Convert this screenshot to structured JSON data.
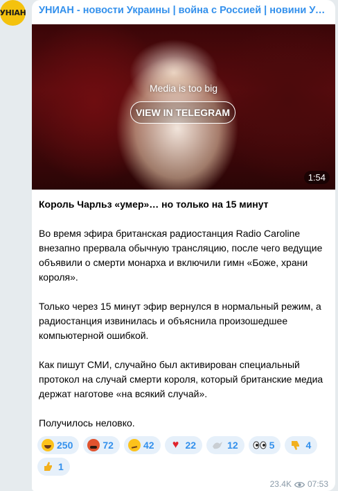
{
  "channel": {
    "avatar_text": "УНІАН",
    "title": "УНИАН - новости Украины | война с Россией | новини України | війна з Росією"
  },
  "media": {
    "notice": "Media is too big",
    "button_label": "VIEW IN TELEGRAM",
    "duration": "1:54"
  },
  "post": {
    "headline": "Король Чарльз «умер»… но только на 15 минут",
    "paragraphs": [
      "Во время эфира британская радиостанция Radio Caroline внезапно прервала обычную трансляцию, после чего ведущие объявили о смерти монарха и включили гимн «Боже, храни короля».",
      "Только через 15 минут эфир вернулся в нормальный режим, а радиостанция извинилась и объяснила произошедшее компьютерной ошибкой.",
      "Как пишут СМИ, случайно был активирован специальный протокол на случай смерти короля, который британские медиа держат наготове «на всякий случай».",
      "Получилось неловко."
    ]
  },
  "reactions": [
    {
      "icon": "grinning-face-icon",
      "count": "250"
    },
    {
      "icon": "angry-face-icon",
      "count": "72"
    },
    {
      "icon": "neutral-face-icon",
      "count": "42"
    },
    {
      "icon": "heart-icon",
      "count": "22"
    },
    {
      "icon": "dove-icon",
      "count": "12"
    },
    {
      "icon": "eyes-icon",
      "count": "5"
    },
    {
      "icon": "thumbs-down-icon",
      "count": "4"
    },
    {
      "icon": "thumbs-up-icon",
      "count": "1"
    }
  ],
  "footer": {
    "views": "23.4K",
    "time": "07:53"
  },
  "colors": {
    "accent": "#3390ec",
    "background": "#e6ebee",
    "bubble": "#ffffff",
    "avatar": "#f4c20d"
  }
}
